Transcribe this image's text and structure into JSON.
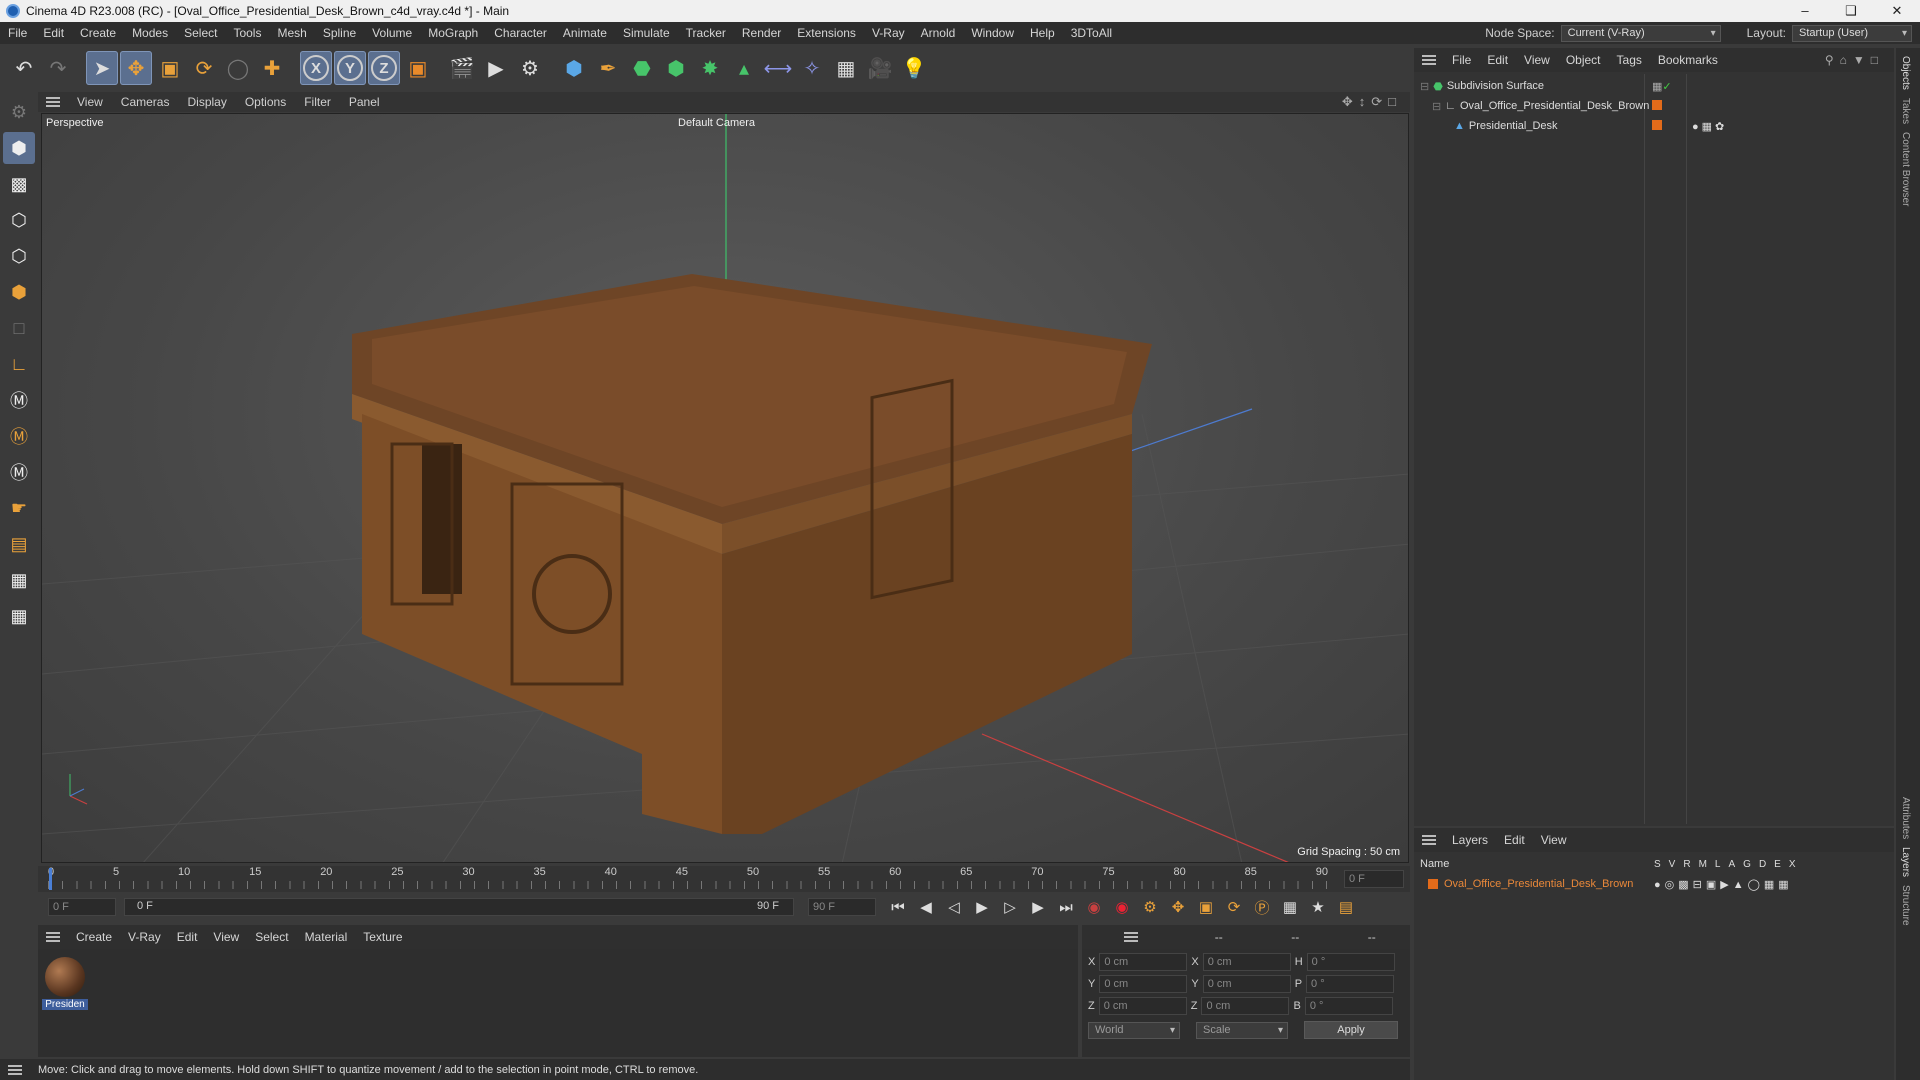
{
  "title": "Cinema 4D R23.008 (RC) - [Oval_Office_Presidential_Desk_Brown_c4d_vray.c4d *] - Main",
  "menu": [
    "File",
    "Edit",
    "Create",
    "Modes",
    "Select",
    "Tools",
    "Mesh",
    "Spline",
    "Volume",
    "MoGraph",
    "Character",
    "Animate",
    "Simulate",
    "Tracker",
    "Render",
    "Extensions",
    "V-Ray",
    "Arnold",
    "Window",
    "Help",
    "3DToAll"
  ],
  "node_space": {
    "label": "Node Space:",
    "value": "Current (V-Ray)"
  },
  "layout": {
    "label": "Layout:",
    "value": "Startup (User)"
  },
  "viewport": {
    "menu": [
      "View",
      "Cameras",
      "Display",
      "Options",
      "Filter",
      "Panel"
    ],
    "label": "Perspective",
    "camera": "Default Camera",
    "grid_spacing": "Grid Spacing : 50 cm"
  },
  "timeline": {
    "ticks": [
      "0",
      "5",
      "10",
      "15",
      "20",
      "25",
      "30",
      "35",
      "40",
      "45",
      "50",
      "55",
      "60",
      "65",
      "70",
      "75",
      "80",
      "85",
      "90"
    ],
    "current_frame": "0 F",
    "start": "0 F",
    "range_start": "0 F",
    "range_end": "90 F",
    "end": "90 F"
  },
  "material_panel": {
    "menu": [
      "Create",
      "V-Ray",
      "Edit",
      "View",
      "Select",
      "Material",
      "Texture"
    ],
    "material_label": "Presiden"
  },
  "coords": {
    "headers": [
      "--",
      "--",
      "--"
    ],
    "rows": [
      {
        "a": "X",
        "av": "0 cm",
        "b": "X",
        "bv": "0 cm",
        "c": "H",
        "cv": "0 °"
      },
      {
        "a": "Y",
        "av": "0 cm",
        "b": "Y",
        "bv": "0 cm",
        "c": "P",
        "cv": "0 °"
      },
      {
        "a": "Z",
        "av": "0 cm",
        "b": "Z",
        "bv": "0 cm",
        "c": "B",
        "cv": "0 °"
      }
    ],
    "world": "World",
    "scale": "Scale",
    "apply": "Apply"
  },
  "status": "Move: Click and drag to move elements. Hold down SHIFT to quantize movement / add to the selection in point mode, CTRL to remove.",
  "objects_panel": {
    "menu": [
      "File",
      "Edit",
      "View",
      "Object",
      "Tags",
      "Bookmarks"
    ],
    "items": [
      "Subdivision Surface",
      "Oval_Office_Presidential_Desk_Brown",
      "Presidential_Desk"
    ]
  },
  "layers_panel": {
    "menu": [
      "Layers",
      "Edit",
      "View"
    ],
    "name_header": "Name",
    "cols": [
      "S",
      "V",
      "R",
      "M",
      "L",
      "A",
      "G",
      "D",
      "E",
      "X"
    ],
    "layer": "Oval_Office_Presidential_Desk_Brown",
    "layer_color": "#e36b1a"
  },
  "right_tabs": [
    "Objects",
    "Takes",
    "Content Browser",
    "Attributes",
    "Layers",
    "Structure"
  ]
}
